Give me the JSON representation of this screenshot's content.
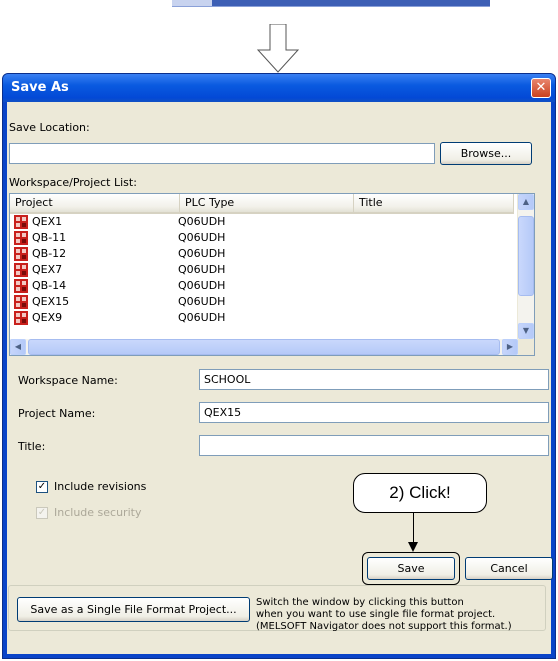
{
  "dialog": {
    "title": "Save As",
    "close_symbol": "✕",
    "save_location": {
      "label": "Save Location:",
      "value": "",
      "browse_label": "Browse..."
    },
    "list": {
      "label": "Workspace/Project List:",
      "columns": [
        "Project",
        "PLC Type",
        "Title"
      ],
      "rows": [
        {
          "project": "QEX1",
          "plc_type": "Q06UDH"
        },
        {
          "project": "QB-11",
          "plc_type": "Q06UDH"
        },
        {
          "project": "QB-12",
          "plc_type": "Q06UDH"
        },
        {
          "project": "QEX7",
          "plc_type": "Q06UDH"
        },
        {
          "project": "QB-14",
          "plc_type": "Q06UDH"
        },
        {
          "project": "QEX15",
          "plc_type": "Q06UDH"
        },
        {
          "project": "QEX9",
          "plc_type": "Q06UDH"
        }
      ]
    },
    "workspace_name": {
      "label": "Workspace Name:",
      "value": "SCHOOL"
    },
    "project_name": {
      "label": "Project Name:",
      "value": "QEX15"
    },
    "title_field": {
      "label": "Title:",
      "value": ""
    },
    "include_revisions": {
      "label": "Include revisions",
      "checked": true
    },
    "include_security": {
      "label": "Include security",
      "checked": true,
      "enabled": false
    },
    "save_label": "Save",
    "cancel_label": "Cancel",
    "single_file_label": "Save as a Single File Format Project...",
    "note_lines": [
      "Switch the window by clicking this button",
      "when you want to use single file format project.",
      "(MELSOFT Navigator does not support this format.)"
    ]
  },
  "annotation": {
    "callout_text": "2) Click!"
  },
  "colors": {
    "title_bar": "#0a5ae0",
    "dialog_bg": "#ece9d8",
    "project_icon": "#c8201c"
  },
  "icons": {
    "project": "plc-project-icon",
    "down_arrow": "down-arrow-icon"
  }
}
